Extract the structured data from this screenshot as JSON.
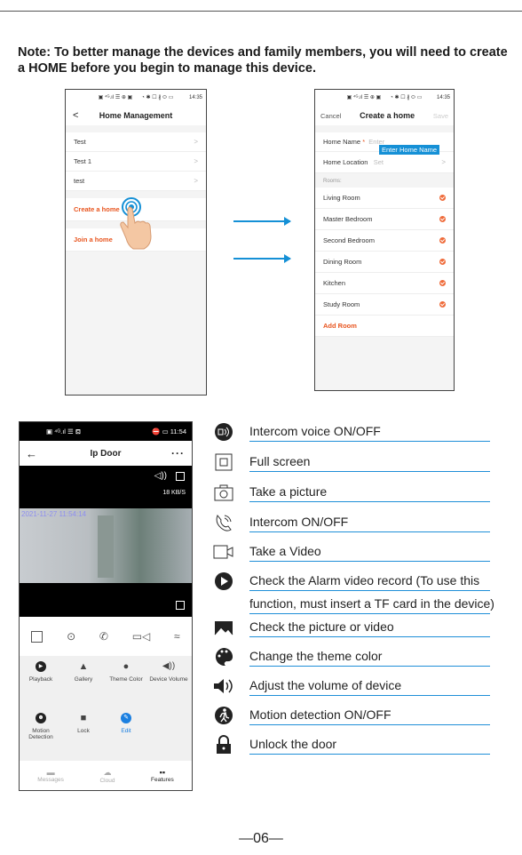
{
  "note": "Note: To better manage the devices and family members, you will need to create a HOME before you begin to manage this device.",
  "phone1": {
    "time": "14:35",
    "title": "Home Management",
    "back": "<",
    "homes": [
      "Test",
      "Test 1",
      "test"
    ],
    "create": "Create a home",
    "join": "Join a home"
  },
  "phone2": {
    "time": "14:35",
    "cancel": "Cancel",
    "title": "Create a home",
    "save": "Save",
    "name_label": "Home Name",
    "name_placeholder": "Enter",
    "tooltip": "Enter Home Name",
    "location_label": "Home Location",
    "location_value": "Set",
    "rooms_label": "Rooms:",
    "rooms": [
      "Living Room",
      "Master Bedroom",
      "Second Bedroom",
      "Dining Room",
      "Kitchen",
      "Study Room"
    ],
    "add_room": "Add Room"
  },
  "phone3": {
    "time": "11:54",
    "title": "Ip Door",
    "more": "···",
    "rate": "18 KB/S",
    "timestamp": "2021-11-27  11:54:14",
    "grid": [
      {
        "label": "Playback"
      },
      {
        "label": "Gallery"
      },
      {
        "label": "Theme Color"
      },
      {
        "label": "Device Volume"
      },
      {
        "label": "Motion Detection"
      },
      {
        "label": "Lock"
      },
      {
        "label": "Edit"
      }
    ],
    "tabs": [
      "Messages",
      "Cloud",
      "Features"
    ]
  },
  "legend": [
    {
      "icon": "speaker-circle-icon",
      "text": "Intercom voice ON/OFF"
    },
    {
      "icon": "fullscreen-icon",
      "text": "Full screen"
    },
    {
      "icon": "camera-icon",
      "text": "Take a picture"
    },
    {
      "icon": "phone-ring-icon",
      "text": "Intercom ON/OFF"
    },
    {
      "icon": "video-icon",
      "text": "Take a Video"
    },
    {
      "icon": "play-icon",
      "text": "Check the Alarm video record (To use this"
    },
    {
      "icon": "",
      "text": "function, must insert a TF card in the device)"
    },
    {
      "icon": "gallery-icon",
      "text": "Check the picture or video"
    },
    {
      "icon": "palette-icon",
      "text": "Change the theme color"
    },
    {
      "icon": "volume-icon",
      "text": "Adjust the volume of device"
    },
    {
      "icon": "motion-icon",
      "text": "Motion detection ON/OFF"
    },
    {
      "icon": "lock-icon",
      "text": "Unlock the door"
    }
  ],
  "page_number": "—06—",
  "colors": {
    "accent_orange": "#e8551f",
    "accent_blue": "#1590d6",
    "edit_blue": "#1b7fe0"
  }
}
